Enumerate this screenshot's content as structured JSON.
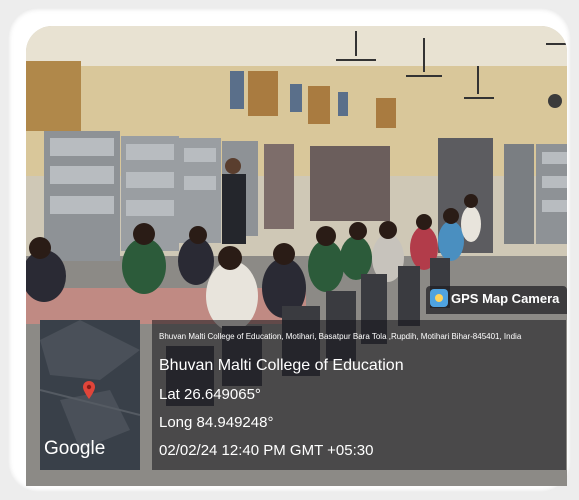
{
  "photo": {
    "subject": "students-in-library-classroom"
  },
  "overlay": {
    "app_badge": "GPS Map Camera",
    "address": "Bhuvan Malti College of Education, Motihari, Basatpur Bara Tola ,Rupdih, Motihari Bihar-845401, India",
    "place_name": "Bhuvan Malti College of Education",
    "latitude": "Lat 26.649065°",
    "longitude": "Long 84.949248°",
    "datetime": "02/02/24 12:40 PM GMT +05:30",
    "map_brand": "Google"
  },
  "icons": [
    "camera-app-icon",
    "map-pin-icon"
  ],
  "colors": {
    "pin": "#e0453a",
    "panel": "#1a1a1f",
    "badge_icon": "#4fa3e0"
  }
}
